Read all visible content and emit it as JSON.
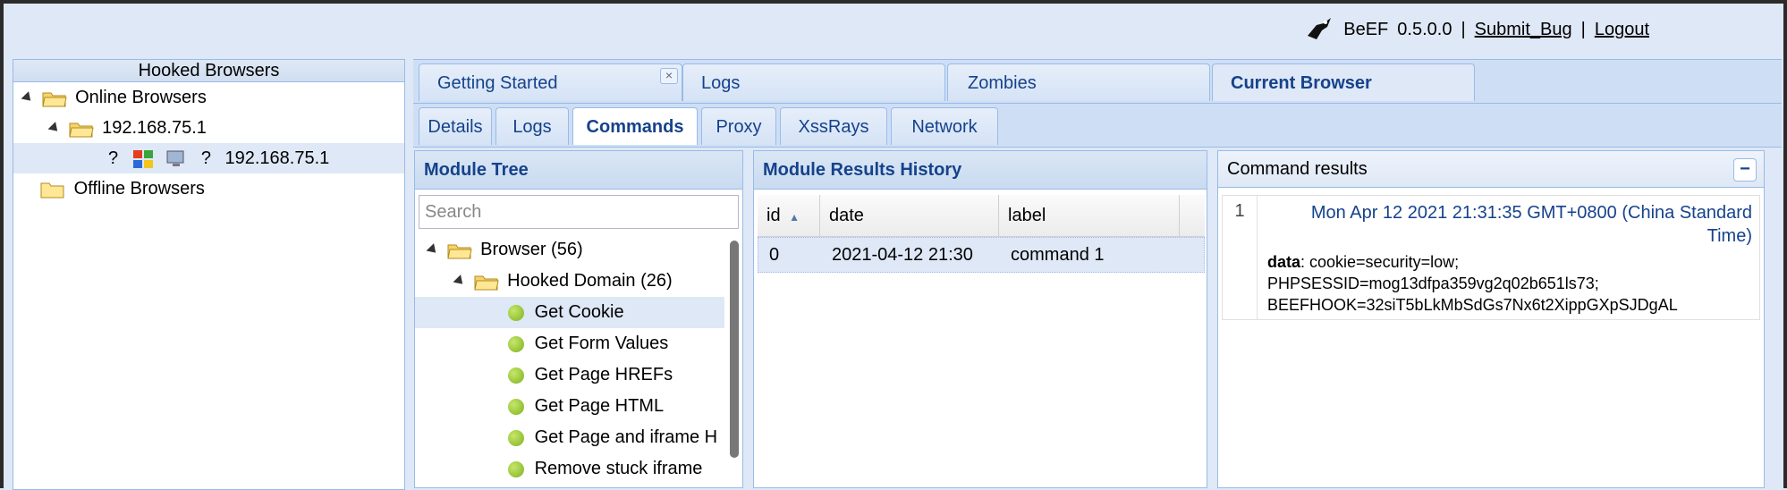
{
  "header": {
    "app_name": "BeEF",
    "version": "0.5.0.0",
    "separator": "|",
    "submit_bug": "Submit_Bug",
    "logout": "Logout"
  },
  "left_panel": {
    "title": "Hooked Browsers",
    "online": "Online Browsers",
    "subnet": "192.168.75.1",
    "browser_q1": "?",
    "browser_q2": "?",
    "browser_ip": "192.168.75.1",
    "offline": "Offline Browsers"
  },
  "main_tabs": [
    "Getting Started",
    "Logs",
    "Zombies",
    "Current Browser"
  ],
  "main_tab_close": "×",
  "sub_tabs": [
    "Details",
    "Logs",
    "Commands",
    "Proxy",
    "XssRays",
    "Network"
  ],
  "module_tree": {
    "title": "Module Tree",
    "search_placeholder": "Search",
    "items": [
      {
        "label": "Browser (56)"
      },
      {
        "label": "Hooked Domain (26)"
      },
      {
        "label": "Get Cookie"
      },
      {
        "label": "Get Form Values"
      },
      {
        "label": "Get Page HREFs"
      },
      {
        "label": "Get Page HTML"
      },
      {
        "label": "Get Page and iframe H"
      },
      {
        "label": "Remove stuck iframe"
      }
    ]
  },
  "results_history": {
    "title": "Module Results History",
    "columns": [
      "id",
      "date",
      "label"
    ],
    "sort_indicator": "▲",
    "rows": [
      {
        "id": "0",
        "date": "2021-04-12 21:30",
        "label": "command 1"
      }
    ]
  },
  "command_results": {
    "title": "Command results",
    "collapse": "−",
    "line_number": "1",
    "date_line1": "Mon Apr 12 2021 21:31:35 GMT+0800 (China Standard",
    "date_line2": "Time)",
    "data_label": "data",
    "data_line1": ": cookie=security=low;",
    "data_line2": "PHPSESSID=mog13dfpa359vg2q02b651ls73;",
    "data_line3": "BEEFHOOK=32siT5bLkMbSdGs7Nx6t2XippGXpSJDgAL"
  },
  "colors": {
    "background": "#dfe8f6",
    "border": "#99bbe8",
    "title_text": "#15428b",
    "module_dot": "#8dc02a"
  }
}
